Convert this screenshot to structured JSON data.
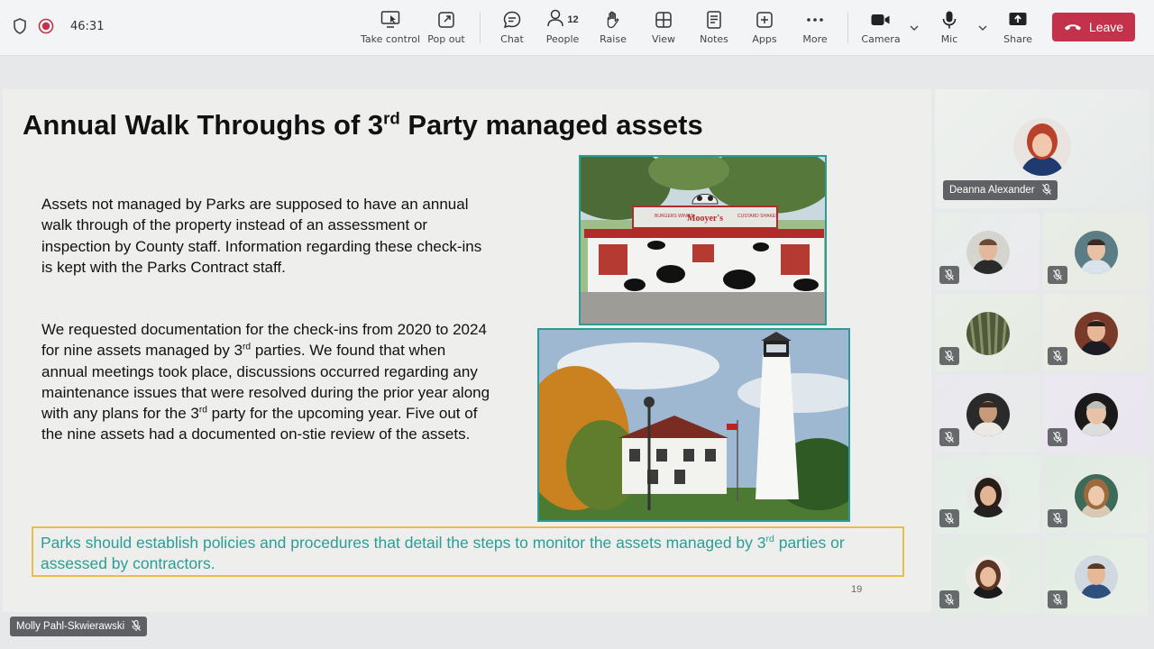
{
  "toolbar": {
    "timer": "46:31",
    "buttons": [
      {
        "label": "Take control",
        "icon": "take-control-icon"
      },
      {
        "label": "Pop out",
        "icon": "pop-out-icon"
      },
      {
        "label": "Chat",
        "icon": "chat-icon"
      },
      {
        "label": "People",
        "icon": "people-icon",
        "count": "12"
      },
      {
        "label": "Raise",
        "icon": "raise-hand-icon"
      },
      {
        "label": "View",
        "icon": "view-icon"
      },
      {
        "label": "Notes",
        "icon": "notes-icon"
      },
      {
        "label": "Apps",
        "icon": "apps-icon"
      },
      {
        "label": "More",
        "icon": "more-icon"
      },
      {
        "label": "Camera",
        "icon": "camera-icon"
      },
      {
        "label": "Mic",
        "icon": "mic-icon"
      },
      {
        "label": "Share",
        "icon": "share-icon"
      }
    ],
    "leave_label": "Leave",
    "leave_color": "#c4314b"
  },
  "slide": {
    "title_prefix": "Annual Walk Throughs of 3",
    "title_sup": "rd",
    "title_suffix": " Party managed assets",
    "paragraph1": "Assets not managed by Parks are supposed to have an annual walk through of the property instead of an assessment or inspection by County staff. Information regarding these check-ins is kept with the Parks Contract staff.",
    "paragraph2_a": "We requested documentation for the check-ins from 2020 to 2024 for nine assets managed by 3",
    "paragraph2_sup1": "rd",
    "paragraph2_b": " parties. We found that when annual meetings took place, discussions occurred regarding any maintenance issues that were resolved during the prior year along with any plans for the 3",
    "paragraph2_sup2": "rd",
    "paragraph2_c": " party for the upcoming year.  Five out of the nine assets had a documented on-stie review of the assets.",
    "photo1_sign_left": "BURGERS WINGS",
    "photo1_sign_center": "Mooyer's",
    "photo1_sign_right": "CUSTARD SHAKES",
    "callout_a": "Parks should establish policies and procedures that detail the steps to monitor the assets managed by 3",
    "callout_sup": "rd",
    "callout_b": " parties or assessed by contractors.",
    "page_number": "19",
    "accent_color": "#2a9d96",
    "callout_border_color": "#e2c04a"
  },
  "participants": {
    "featured_name": "Deanna Alexander",
    "presenter_name": "Molly Pahl-Skwierawski",
    "tiles_muted": [
      true,
      true,
      true,
      true,
      true,
      true,
      true,
      true,
      true,
      true
    ]
  }
}
